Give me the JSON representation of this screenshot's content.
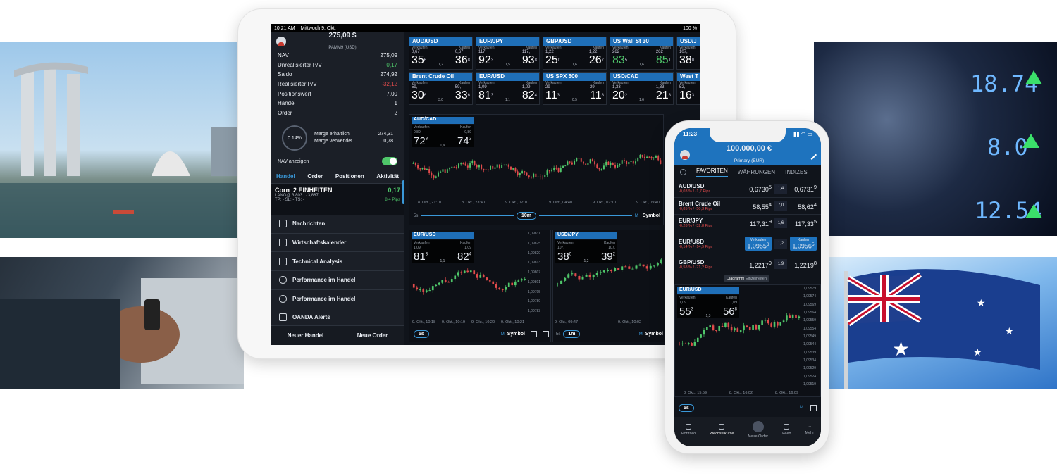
{
  "tablet": {
    "status": {
      "time": "10:21 AM",
      "date": "Mittwoch 9. Okt.",
      "battery": "100 %"
    },
    "account": {
      "amount": "275,09 $",
      "name": "PAMM9 (USD)"
    },
    "stats": [
      {
        "label": "NAV",
        "value": "275,09",
        "tone": ""
      },
      {
        "label": "Unrealisierter P/V",
        "value": "0,17",
        "tone": "pos"
      },
      {
        "label": "Saldo",
        "value": "274,92",
        "tone": ""
      },
      {
        "label": "Realisierter P/V",
        "value": "-32,12",
        "tone": "neg"
      },
      {
        "label": "Positionswert",
        "value": "7,00",
        "tone": ""
      },
      {
        "label": "Handel",
        "value": "1",
        "tone": ""
      },
      {
        "label": "Order",
        "value": "2",
        "tone": ""
      }
    ],
    "margin": {
      "pct": "0.14%",
      "l1": "Marge erhältlich",
      "l2": "Marge verwendet",
      "v1": "274,31",
      "v2": "0,78"
    },
    "nav_toggle_label": "NAV anzeigen",
    "tabs": [
      "Handel",
      "Order",
      "Positionen",
      "Aktivität"
    ],
    "trade": {
      "name": "Corn",
      "units": "2 EINHEITEN",
      "pnl": "0,17",
      "line2": "LANG@ 3,803 →3,887",
      "line3": "TP: -   SL: -   TS: -",
      "pips": "8,4 Pips"
    },
    "menu": [
      "Nachrichten",
      "Wirtschaftskalender",
      "Technical Analysis",
      "Performance im Handel",
      "Performance im Handel",
      "OANDA Alerts"
    ],
    "bottom": [
      "Neuer Handel",
      "Neue Order"
    ],
    "tiles": [
      {
        "pair": "AUD/USD",
        "sl": "Verkaufen",
        "bl": "Kaufen",
        "sp": "0,67",
        "sb": "35",
        "ss": "6",
        "spread": "1,2",
        "bp": "0,67",
        "bb": "36",
        "bs": "8",
        "green": false
      },
      {
        "pair": "EUR/JPY",
        "sl": "Verkaufen",
        "bl": "Kaufen",
        "sp": "117,",
        "sb": "92",
        "ss": "3",
        "spread": "1,5",
        "bp": "117,",
        "bb": "93",
        "bs": "8",
        "green": false
      },
      {
        "pair": "GBP/USD",
        "sl": "Verkaufen",
        "bl": "Kaufen",
        "sp": "1,22",
        "sb": "25",
        "ss": "0",
        "spread": "1,6",
        "bp": "1,22",
        "bb": "26",
        "bs": "7",
        "green": false
      },
      {
        "pair": "US Wall St 30",
        "sl": "Verkaufen",
        "bl": "Kaufen",
        "sp": "262",
        "sb": "83",
        "ss": "5",
        "spread": "1,6",
        "bp": "262",
        "bb": "85",
        "bs": "1",
        "green": true
      },
      {
        "pair": "USD/J",
        "sl": "Verkaufen",
        "bl": "",
        "sp": "107,",
        "sb": "38",
        "ss": "0",
        "spread": "",
        "bp": "",
        "bb": "",
        "bs": "",
        "green": false
      },
      {
        "pair": "Brent Crude Oil",
        "sl": "Verkaufen",
        "bl": "Kaufen",
        "sp": "59,",
        "sb": "30",
        "ss": "6",
        "spread": "3,0",
        "bp": "59,",
        "bb": "33",
        "bs": "6",
        "green": false
      },
      {
        "pair": "EUR/USD",
        "sl": "Verkaufen",
        "bl": "Kaufen",
        "sp": "1,09",
        "sb": "81",
        "ss": "3",
        "spread": "1,1",
        "bp": "1,09",
        "bb": "82",
        "bs": "4",
        "green": false
      },
      {
        "pair": "US SPX 500",
        "sl": "Verkaufen",
        "bl": "Kaufen",
        "sp": "29",
        "sb": "11",
        "ss": "3",
        "spread": "0,5",
        "bp": "29",
        "bb": "11",
        "bs": "8",
        "green": false
      },
      {
        "pair": "USD/CAD",
        "sl": "Verkaufen",
        "bl": "Kaufen",
        "sp": "1,33",
        "sb": "20",
        "ss": "2",
        "spread": "1,6",
        "bp": "1,33",
        "bb": "21",
        "bs": "8",
        "green": false
      },
      {
        "pair": "West T",
        "sl": "Verkaufen",
        "bl": "",
        "sp": "52,",
        "sb": "16",
        "ss": "3",
        "spread": "",
        "bp": "",
        "bb": "",
        "bs": "",
        "green": false
      }
    ],
    "chart_main": {
      "pair": "AUD/CAD",
      "sl": "Verkaufen",
      "bl": "Kaufen",
      "sp": "0,89",
      "sb": "72",
      "ss": "3",
      "spread": "1,9",
      "bp": "0,89",
      "bb": "74",
      "bs": "2",
      "x": [
        "8. Okt., 21:10",
        "8. Okt., 23:40",
        "9. Okt., 02:10",
        "9. Okt., 04:40",
        "9. Okt., 07:10",
        "9. Okt., 09:40"
      ],
      "range_left": "5s",
      "interval": "10m",
      "range_right": "M",
      "symbol": "Symbol"
    },
    "chart_eu": {
      "pair": "EUR/USD",
      "sl": "Verkaufen",
      "bl": "Kaufen",
      "sp": "1,09",
      "sb": "81",
      "ss": "3",
      "spread": "1,1",
      "bp": "1,09",
      "bb": "82",
      "bs": "4",
      "y": [
        "1,09831",
        "1,09825",
        "1,09820",
        "1,09813",
        "1,09807",
        "1,09801",
        "1,09795",
        "1,09789",
        "1,09783"
      ],
      "x": [
        "9. Okt., 10:18",
        "9. Okt., 10:19",
        "9. Okt., 10:20",
        "9. Okt., 10:21"
      ],
      "interval": "5s",
      "range_right": "M",
      "symbol": "Symbol"
    },
    "chart_uj": {
      "pair": "USD/JPY",
      "sl": "Verkaufen",
      "bl": "Kaufen",
      "sp": "107,",
      "sb": "38",
      "ss": "0",
      "spread": "1,2",
      "bp": "107,",
      "bb": "39",
      "bs": "2",
      "x": [
        "9. Okt., 09:47",
        "9. Okt., 10:02"
      ],
      "range_left": "5s",
      "interval": "1m",
      "range_right": "M",
      "symbol": "Symbol"
    }
  },
  "phone": {
    "status": {
      "time": "11:23"
    },
    "account": {
      "amount": "100.000,00 €",
      "name": "Primary (EUR)"
    },
    "tabs": [
      "FAVORITEN",
      "WÄHRUNGEN",
      "INDIZES"
    ],
    "rows": [
      {
        "pair": "AUD/USD",
        "change": "-0,03 % / -1,7 Pips",
        "sell": "0,6730",
        "ss": "5",
        "spread": "1,4",
        "buy": "0,6731",
        "bs": "9",
        "sel": false
      },
      {
        "pair": "Brent Crude Oil",
        "change": "-0,85 % / -50,3 Pips",
        "sell": "58,55",
        "ss": "4",
        "spread": "7,0",
        "buy": "58,62",
        "bs": "4",
        "sel": false
      },
      {
        "pair": "EUR/JPY",
        "change": "-0,28 % / -32,8 Pips",
        "sell": "117,31",
        "ss": "9",
        "spread": "1,6",
        "buy": "117,33",
        "bs": "5",
        "sel": false
      },
      {
        "pair": "EUR/USD",
        "change": "-0,14 % / -14,9 Pips",
        "sell": "1,0955",
        "ss": "3",
        "spread": "1,2",
        "buy": "1,0956",
        "bs": "5",
        "sel": true,
        "sl": "Verkaufen",
        "bl": "Kaufen"
      },
      {
        "pair": "GBP/USD",
        "change": "-0,58 % / -71,2 Pips",
        "sell": "1,2217",
        "ss": "9",
        "spread": "1,9",
        "buy": "1,2219",
        "bs": "8",
        "sel": false
      }
    ],
    "tooltip": [
      "Diagramm",
      "Einzelheiten"
    ],
    "chart": {
      "pair": "EUR/USD",
      "sl": "Verkaufen",
      "bl": "Kaufen",
      "sp": "1,09",
      "sb": "55",
      "ss": "3",
      "spread": "1,3",
      "bp": "1,09",
      "bb": "56",
      "bs": "8",
      "y": [
        "1,09579",
        "1,09574",
        "1,09569",
        "1,09564",
        "1,09559",
        "1,09554",
        "1,09549",
        "1,09544",
        "1,09539",
        "1,09534",
        "1,09529",
        "1,09524",
        "1,09519"
      ],
      "x": [
        "8. Okt., 15:59",
        "8. Okt., 16:02",
        "8. Okt., 16:09"
      ],
      "interval": "5s",
      "range_right": "M"
    },
    "nav": [
      "Portfolio",
      "Wechselkurse",
      "Neue Order",
      "Feed",
      "Mehr"
    ]
  },
  "colors": {
    "accent": "#1f6fb8",
    "up": "#4fc76a",
    "down": "#e24b4b",
    "bg": "#10141b"
  }
}
